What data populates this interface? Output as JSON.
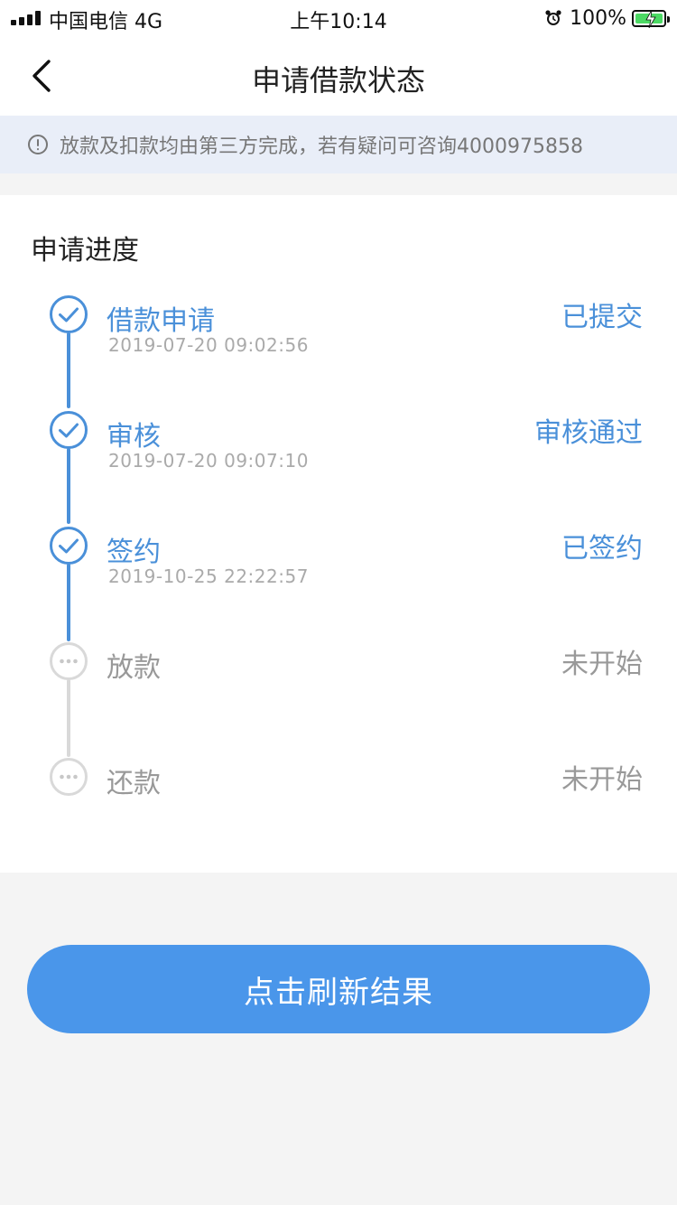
{
  "status_bar": {
    "carrier": "中国电信  4G",
    "time": "上午10:14",
    "battery": "100%",
    "icons": [
      "signal-icon",
      "alarm-icon",
      "battery-icon"
    ]
  },
  "nav": {
    "title": "申请借款状态",
    "back_icon": "chevron-left-icon"
  },
  "notice": {
    "icon": "info-icon",
    "text": "放款及扣款均由第三方完成，若有疑问可咨询4000975858"
  },
  "progress": {
    "title": "申请进度",
    "steps": [
      {
        "name": "借款申请",
        "time": "2019-07-20 09:02:56",
        "status": "已提交",
        "state": "done"
      },
      {
        "name": "审核",
        "time": "2019-07-20 09:07:10",
        "status": "审核通过",
        "state": "done"
      },
      {
        "name": "签约",
        "time": "2019-10-25 22:22:57",
        "status": "已签约",
        "state": "done"
      },
      {
        "name": "放款",
        "time": "",
        "status": "未开始",
        "state": "pending"
      },
      {
        "name": "还款",
        "time": "",
        "status": "未开始",
        "state": "pending"
      }
    ]
  },
  "refresh_button": {
    "label": "点击刷新结果"
  },
  "colors": {
    "accent": "#4a90d9",
    "button": "#4a96ea",
    "pending": "#d9d9d9",
    "notice_bg": "#e9eef8",
    "page_bg": "#f4f4f4"
  }
}
